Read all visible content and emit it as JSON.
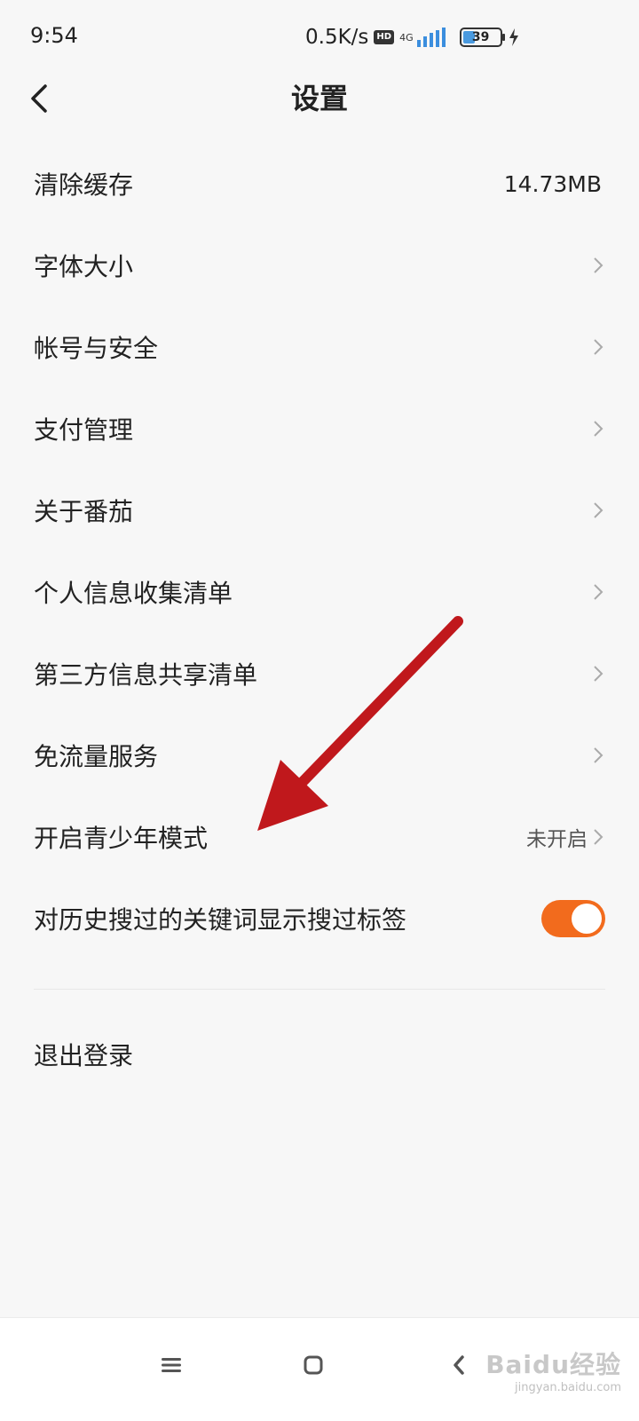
{
  "status_bar": {
    "time": "9:54",
    "speed": "0.5K/s",
    "hd": "HD",
    "network": "4G",
    "battery": "39",
    "battery_level": 0.39
  },
  "header": {
    "title": "设置"
  },
  "settings": {
    "items": [
      {
        "label": "清除缓存",
        "value": "14.73MB"
      },
      {
        "label": "字体大小"
      },
      {
        "label": "帐号与安全"
      },
      {
        "label": "支付管理"
      },
      {
        "label": "关于番茄"
      },
      {
        "label": "个人信息收集清单"
      },
      {
        "label": "第三方信息共享清单"
      },
      {
        "label": "免流量服务"
      },
      {
        "label": "开启青少年模式",
        "value": "未开启"
      },
      {
        "label": "对历史搜过的关键词显示搜过标签",
        "toggle_on": true
      }
    ],
    "logout_label": "退出登录"
  },
  "colors": {
    "accent": "#f26b1d",
    "annotation_arrow": "#c0181c",
    "background": "#f7f7f7"
  },
  "watermark": {
    "brand": "Baidu经验",
    "url": "jingyan.baidu.com"
  }
}
